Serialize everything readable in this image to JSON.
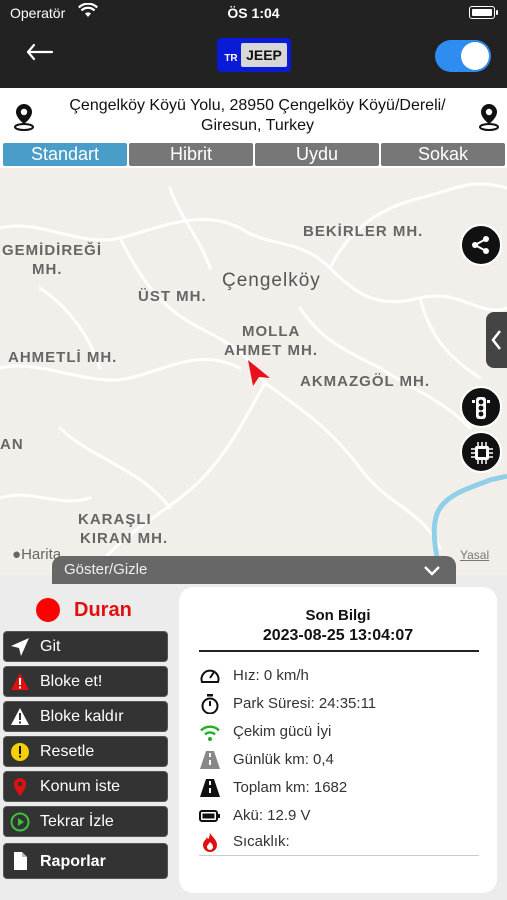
{
  "status_bar": {
    "carrier": "Operatör",
    "time": "ÖS 1:04"
  },
  "header": {
    "logo_prefix": "TR",
    "logo_text": "JEEP",
    "toggle_on": true
  },
  "address": {
    "text": "Çengelköy Köyü Yolu, 28950 Çengelköy Köyü/Dereli/ Giresun, Turkey"
  },
  "map_tabs": [
    {
      "label": "Standart",
      "active": true
    },
    {
      "label": "Hibrit",
      "active": false
    },
    {
      "label": "Uydu",
      "active": false
    },
    {
      "label": "Sokak",
      "active": false
    }
  ],
  "map": {
    "labels": [
      {
        "text": "BEKİRLER MH."
      },
      {
        "text": "GEMİDİREĞİ"
      },
      {
        "text": "MH."
      },
      {
        "text": "Çengelköy"
      },
      {
        "text": "ÜST MH."
      },
      {
        "text": "MOLLA"
      },
      {
        "text": "AHMET MH."
      },
      {
        "text": "AHMETLİ MH."
      },
      {
        "text": "AKMAZGÖL MH."
      },
      {
        "text": "AN"
      },
      {
        "text": "KARAŞLI"
      },
      {
        "text": "KIRAN MH."
      }
    ],
    "attribution": "Harita",
    "legal": "Yasal"
  },
  "panel_toggle": {
    "label": "Göster/Gizle"
  },
  "vehicle_status": {
    "label": "Duran",
    "color": "#ff0000"
  },
  "commands": [
    {
      "label": "Git",
      "icon": "send-icon"
    },
    {
      "label": "Bloke et!",
      "icon": "warning-red-icon"
    },
    {
      "label": "Bloke kaldır",
      "icon": "warning-white-icon"
    },
    {
      "label": "Resetle",
      "icon": "exclamation-yellow-icon"
    },
    {
      "label": "Konum iste",
      "icon": "location-pin-icon"
    },
    {
      "label": "Tekrar İzle",
      "icon": "replay-icon"
    },
    {
      "label": "Raporlar",
      "icon": "document-icon"
    }
  ],
  "info_card": {
    "title": "Son Bilgi",
    "datetime": "2023-08-25 13:04:07",
    "rows": [
      {
        "icon": "speedometer-icon",
        "text": "Hız: 0  km/h"
      },
      {
        "icon": "stopwatch-icon",
        "text": "Park Süresi: 24:35:11"
      },
      {
        "icon": "wifi-signal-icon",
        "text": "Çekim gücü İyi"
      },
      {
        "icon": "road-icon",
        "text": "Günlük km: 0,4"
      },
      {
        "icon": "highway-icon",
        "text": "Toplam km: 1682"
      },
      {
        "icon": "battery-icon",
        "text": "Akü: 12.9 V"
      },
      {
        "icon": "flame-icon",
        "text": "Sıcaklık:"
      }
    ]
  },
  "colors": {
    "accent": "#4a9cc9",
    "toggle": "#2f8cf1",
    "brand": "#0a1bd8",
    "stopped": "#e01010"
  }
}
